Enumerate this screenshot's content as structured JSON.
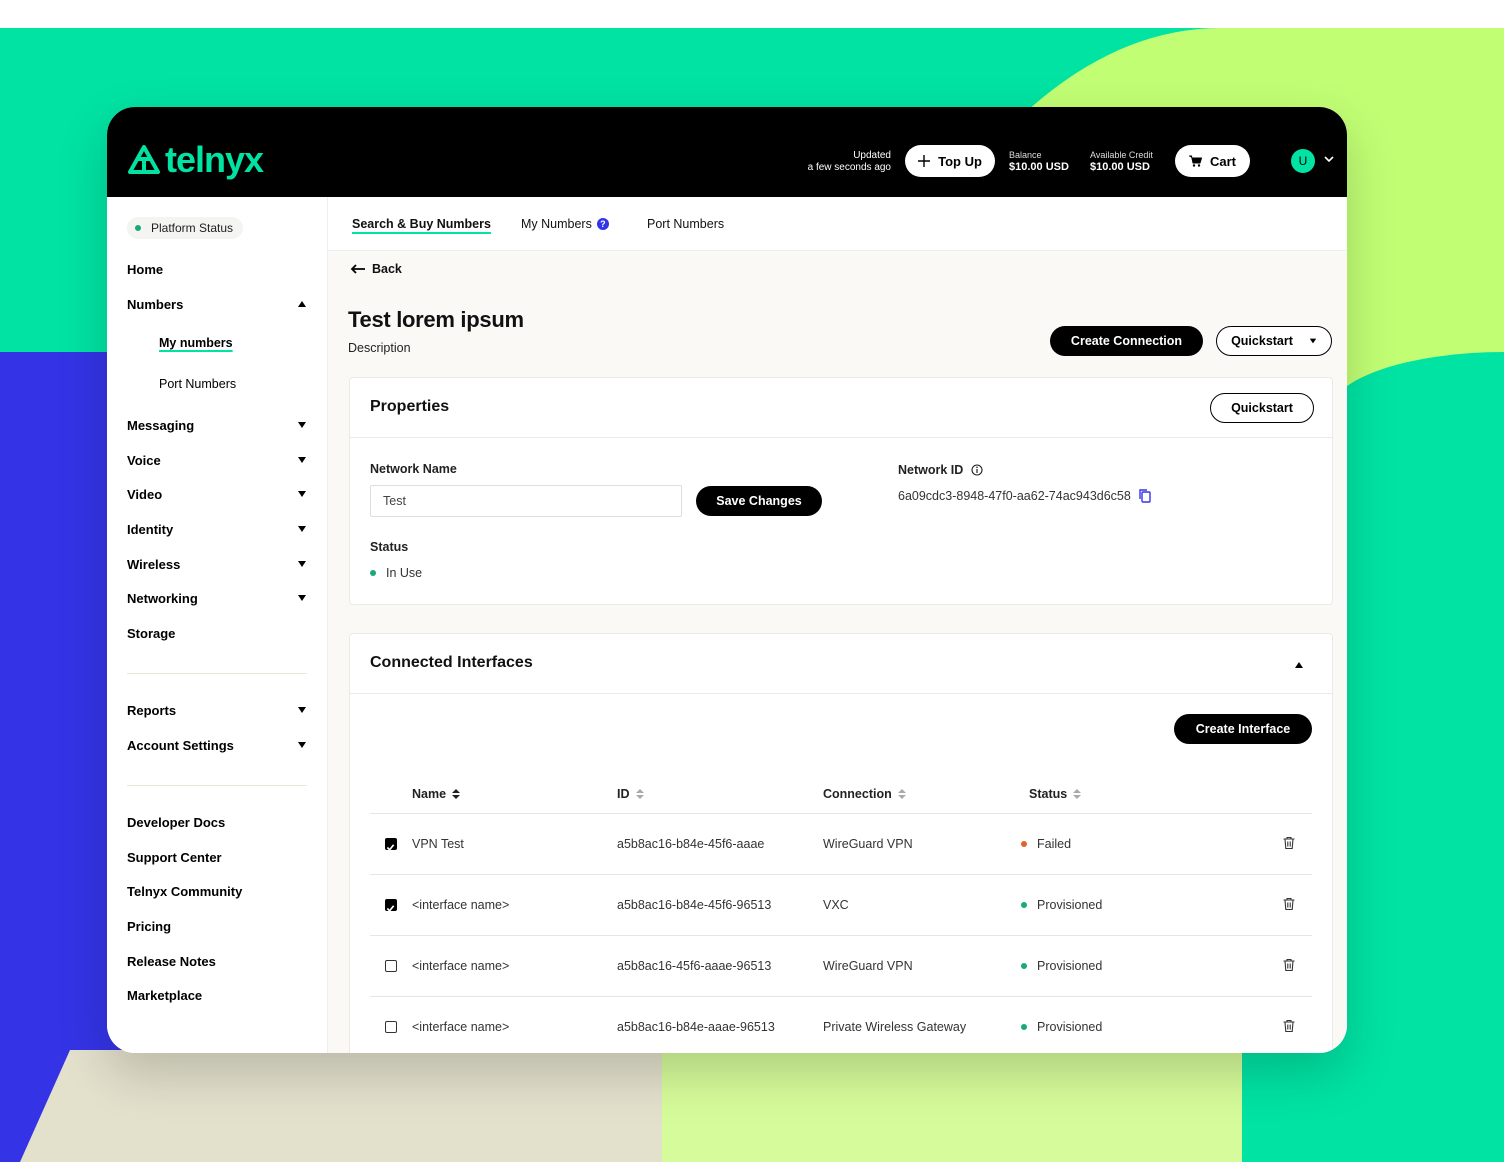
{
  "brand": {
    "name": "telnyx",
    "accent": "#00e3a3",
    "blue": "#3434e6",
    "lime": "#c1fe74"
  },
  "topbar": {
    "updated_line1": "Updated",
    "updated_line2": "a few seconds ago",
    "top_up_label": "Top Up",
    "balance_label": "Balance",
    "balance_value": "$10.00 USD",
    "credit_label": "Available Credit",
    "credit_value": "$10.00 USD",
    "cart_label": "Cart",
    "avatar_initial": "U"
  },
  "sidebar": {
    "platform_status": "Platform Status",
    "items": [
      {
        "label": "Home"
      },
      {
        "label": "Numbers",
        "expanded": true
      },
      {
        "label": "My numbers",
        "active": true
      },
      {
        "label": "Port Numbers"
      },
      {
        "label": "Messaging"
      },
      {
        "label": "Voice"
      },
      {
        "label": "Video"
      },
      {
        "label": "Identity"
      },
      {
        "label": "Wireless"
      },
      {
        "label": "Networking"
      },
      {
        "label": "Storage"
      },
      {
        "label": "Reports"
      },
      {
        "label": "Account Settings"
      },
      {
        "label": "Developer Docs"
      },
      {
        "label": "Support Center"
      },
      {
        "label": "Telnyx Community"
      },
      {
        "label": "Pricing"
      },
      {
        "label": "Release Notes"
      },
      {
        "label": "Marketplace"
      }
    ]
  },
  "subnav": {
    "tabs": [
      {
        "label": "Search & Buy Numbers",
        "active": true
      },
      {
        "label": "My Numbers"
      },
      {
        "label": "Port Numbers"
      }
    ]
  },
  "page": {
    "back_label": "Back",
    "title": "Test lorem ipsum",
    "description": "Description",
    "create_connection_label": "Create Connection",
    "quickstart_label": "Quickstart"
  },
  "properties": {
    "title": "Properties",
    "quickstart_label": "Quickstart",
    "network_name_label": "Network Name",
    "network_name_value": "Test",
    "save_label": "Save Changes",
    "network_id_label": "Network ID",
    "network_id_value": "6a09cdc3-8948-47f0-aa62-74ac943d6c58",
    "status_label": "Status",
    "status_value": "In Use"
  },
  "interfaces": {
    "title": "Connected Interfaces",
    "create_label": "Create Interface",
    "columns": [
      "Name",
      "ID",
      "Connection",
      "Status"
    ],
    "rows": [
      {
        "checked": true,
        "name": "VPN Test",
        "id": "a5b8ac16-b84e-45f6-aaae",
        "connection": "WireGuard VPN",
        "status": "Failed",
        "status_color": "#e5602a"
      },
      {
        "checked": true,
        "name": "<interface name>",
        "id": "a5b8ac16-b84e-45f6-96513",
        "connection": "VXC",
        "status": "Provisioned",
        "status_color": "#19a974"
      },
      {
        "checked": false,
        "name": "<interface name>",
        "id": "a5b8ac16-45f6-aaae-96513",
        "connection": "WireGuard VPN",
        "status": "Provisioned",
        "status_color": "#19a974"
      },
      {
        "checked": false,
        "name": "<interface name>",
        "id": "a5b8ac16-b84e-aaae-96513",
        "connection": "Private Wireless Gateway",
        "status": "Provisioned",
        "status_color": "#19a974"
      }
    ]
  }
}
